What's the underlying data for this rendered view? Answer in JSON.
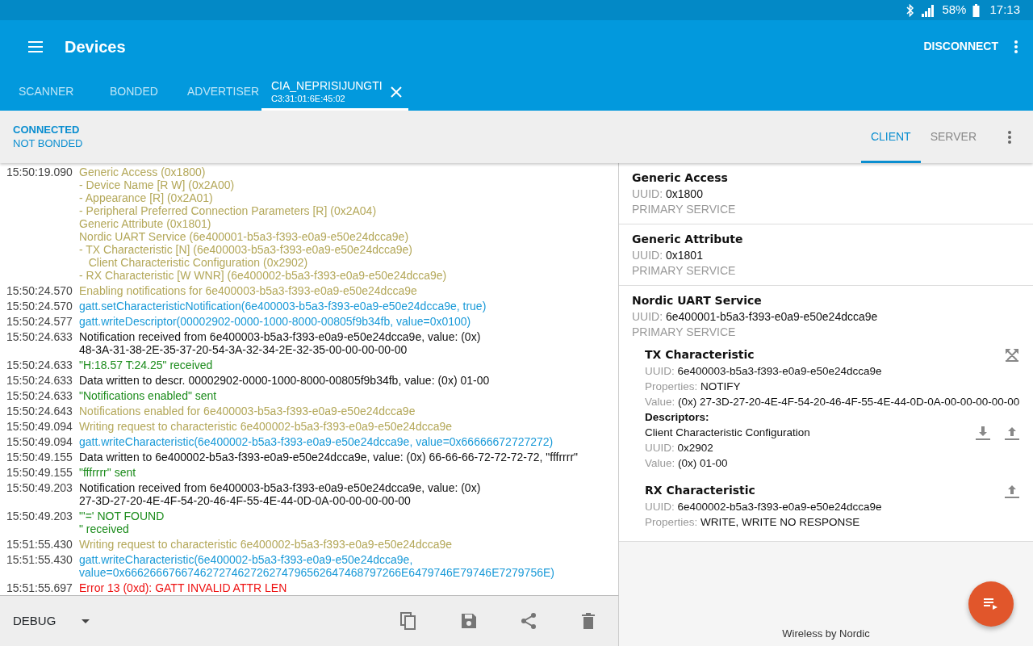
{
  "status_bar": {
    "battery": "58%",
    "time": "17:13"
  },
  "app_bar": {
    "title": "Devices",
    "action": "DISCONNECT"
  },
  "tabs": [
    {
      "label": "SCANNER",
      "selected": false
    },
    {
      "label": "BONDED",
      "selected": false
    },
    {
      "label": "ADVERTISER",
      "selected": false
    },
    {
      "label": "CIA_NEPRISIJUNGTI",
      "subtitle": "C3:31:01:6E:45:02",
      "closable": true,
      "selected": true
    }
  ],
  "connection": {
    "state": "CONNECTED",
    "bonding": "NOT BONDED"
  },
  "mode_tabs": [
    {
      "label": "CLIENT",
      "selected": true
    },
    {
      "label": "SERVER",
      "selected": false
    }
  ],
  "log": [
    {
      "time": "15:50:19.090",
      "kind": "app",
      "lines": [
        "Generic Access (0x1800)",
        "- Device Name [R W] (0x2A00)",
        "- Appearance [R] (0x2A01)",
        "- Peripheral Preferred Connection Parameters [R] (0x2A04)",
        "Generic Attribute (0x1801)",
        "Nordic UART Service (6e400001-b5a3-f393-e0a9-e50e24dcca9e)",
        "- TX Characteristic [N] (6e400003-b5a3-f393-e0a9-e50e24dcca9e)",
        "   Client Characteristic Configuration (0x2902)",
        "- RX Characteristic [W WNR] (6e400002-b5a3-f393-e0a9-e50e24dcca9e)"
      ]
    },
    {
      "time": "15:50:24.570",
      "kind": "app",
      "lines": [
        "Enabling notifications for 6e400003-b5a3-f393-e0a9-e50e24dcca9e"
      ]
    },
    {
      "time": "15:50:24.570",
      "kind": "gatt",
      "lines": [
        "gatt.setCharacteristicNotification(6e400003-b5a3-f393-e0a9-e50e24dcca9e, true)"
      ]
    },
    {
      "time": "15:50:24.577",
      "kind": "gatt",
      "lines": [
        "gatt.writeDescriptor(00002902-0000-1000-8000-00805f9b34fb, value=0x0100)"
      ]
    },
    {
      "time": "15:50:24.633",
      "kind": "info",
      "lines": [
        "Notification received from 6e400003-b5a3-f393-e0a9-e50e24dcca9e, value: (0x)",
        "48-3A-31-38-2E-35-37-20-54-3A-32-34-2E-32-35-00-00-00-00-00"
      ]
    },
    {
      "time": "15:50:24.633",
      "kind": "data",
      "lines": [
        "\"H:18.57 T:24.25\" received"
      ]
    },
    {
      "time": "15:50:24.633",
      "kind": "info",
      "lines": [
        "Data written to descr. 00002902-0000-1000-8000-00805f9b34fb, value: (0x) 01-00"
      ]
    },
    {
      "time": "15:50:24.633",
      "kind": "data",
      "lines": [
        "\"Notifications enabled\" sent"
      ]
    },
    {
      "time": "15:50:24.643",
      "kind": "app",
      "lines": [
        "Notifications enabled for 6e400003-b5a3-f393-e0a9-e50e24dcca9e"
      ]
    },
    {
      "time": "15:50:49.094",
      "kind": "app",
      "lines": [
        "Writing request to characteristic 6e400002-b5a3-f393-e0a9-e50e24dcca9e"
      ]
    },
    {
      "time": "15:50:49.094",
      "kind": "gatt",
      "lines": [
        "gatt.writeCharacteristic(6e400002-b5a3-f393-e0a9-e50e24dcca9e, value=0x66666672727272)"
      ]
    },
    {
      "time": "15:50:49.155",
      "kind": "info",
      "lines": [
        "Data written to 6e400002-b5a3-f393-e0a9-e50e24dcca9e, value: (0x) 66-66-66-72-72-72-72, \"fffrrrr\""
      ]
    },
    {
      "time": "15:50:49.155",
      "kind": "data",
      "lines": [
        "\"fffrrrr\" sent"
      ]
    },
    {
      "time": "15:50:49.203",
      "kind": "info",
      "lines": [
        "Notification received from 6e400003-b5a3-f393-e0a9-e50e24dcca9e, value: (0x)",
        "27-3D-27-20-4E-4F-54-20-46-4F-55-4E-44-0D-0A-00-00-00-00-00"
      ]
    },
    {
      "time": "15:50:49.203",
      "kind": "data",
      "lines": [
        "\"'=' NOT FOUND",
        "\" received"
      ]
    },
    {
      "time": "15:51:55.430",
      "kind": "app",
      "lines": [
        "Writing request to characteristic 6e400002-b5a3-f393-e0a9-e50e24dcca9e"
      ]
    },
    {
      "time": "15:51:55.430",
      "kind": "gatt",
      "lines": [
        "gatt.writeCharacteristic(6e400002-b5a3-f393-e0a9-e50e24dcca9e,",
        "value=0x66626667667462727462726274796562647468797266E6479746E79746E7279756E)"
      ]
    },
    {
      "time": "15:51:55.697",
      "kind": "error",
      "lines": [
        "Error 13 (0xd): GATT INVALID ATTR LEN"
      ]
    }
  ],
  "log_level": "DEBUG",
  "services": [
    {
      "name": "Generic Access",
      "uuid_label": "UUID:",
      "uuid": "0x1800",
      "type": "PRIMARY SERVICE"
    },
    {
      "name": "Generic Attribute",
      "uuid_label": "UUID:",
      "uuid": "0x1801",
      "type": "PRIMARY SERVICE"
    },
    {
      "name": "Nordic UART Service",
      "uuid_label": "UUID:",
      "uuid": "6e400001-b5a3-f393-e0a9-e50e24dcca9e",
      "type": "PRIMARY SERVICE",
      "characteristics": [
        {
          "name": "TX Characteristic",
          "actions": [
            {
              "kind": "notify"
            }
          ],
          "fields": [
            {
              "label": "UUID:",
              "value": "6e400003-b5a3-f393-e0a9-e50e24dcca9e"
            },
            {
              "label": "Properties:",
              "value": "NOTIFY"
            },
            {
              "label": "Value:",
              "value": "(0x) 27-3D-27-20-4E-4F-54-20-46-4F-55-4E-44-0D-0A-00-00-00-00-00"
            }
          ],
          "descriptors_heading": "Descriptors:",
          "descriptors": [
            {
              "name": "Client Characteristic Configuration",
              "actions": [
                {
                  "kind": "read"
                },
                {
                  "kind": "write"
                }
              ],
              "fields": [
                {
                  "label": "UUID:",
                  "value": "0x2902"
                },
                {
                  "label": "Value:",
                  "value": "(0x) 01-00"
                }
              ]
            }
          ]
        },
        {
          "name": "RX Characteristic",
          "actions": [
            {
              "kind": "write"
            }
          ],
          "fields": [
            {
              "label": "UUID:",
              "value": "6e400002-b5a3-f393-e0a9-e50e24dcca9e"
            },
            {
              "label": "Properties:",
              "value": "WRITE, WRITE NO RESPONSE"
            }
          ]
        }
      ]
    }
  ],
  "footer": "Wireless by Nordic"
}
